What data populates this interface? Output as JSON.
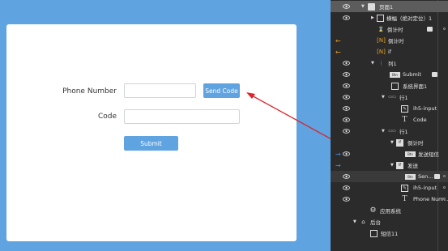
{
  "form": {
    "phone_label": "Phone Number",
    "send_code_label": "Send Code",
    "code_label": "Code",
    "submit_label": "Submit"
  },
  "layers": {
    "root": "页面1",
    "banner": "横幅（绝对定位）1",
    "countdown_a": "倒计时",
    "countdown_b": "倒计时",
    "if": "if",
    "column": "列1",
    "submit": "Submit",
    "system_page": "系统界面1",
    "row_a": "行1",
    "ih5_input_a": "ih5-input",
    "code_text": "Code",
    "row_b": "行1",
    "countdown_c": "倒计时",
    "send_sms": "发送短信",
    "send": "发送",
    "send_short": "Sen...",
    "ih5_input_b": "ih5-input",
    "phone_text": "Phone Num...",
    "app_system": "应用系统",
    "backend": "后台",
    "sms": "短信11"
  },
  "colors": {
    "canvas_bg": "#5fa3e0",
    "button_bg": "#5fa3e0",
    "panel_bg": "#2b2b2b",
    "arrow": "#d9262b",
    "lock": "#e8a020",
    "link": "#4a8fe8"
  }
}
